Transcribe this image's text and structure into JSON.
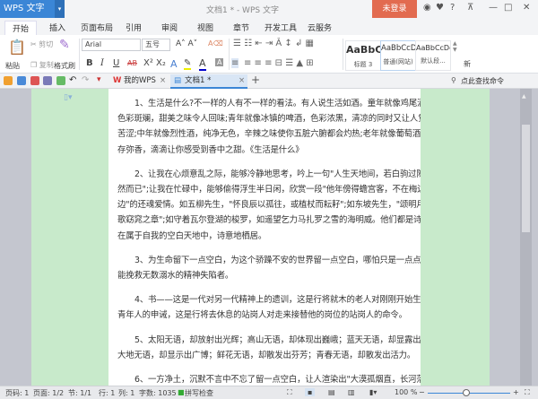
{
  "window": {
    "app_name": "WPS 文字",
    "title": "文档1 * - WPS 文字",
    "login": "未登录",
    "help": "?"
  },
  "tabs": [
    "开始",
    "插入",
    "页面布局",
    "引用",
    "审阅",
    "视图",
    "章节",
    "开发工具",
    "云服务"
  ],
  "ribbon": {
    "paste": "粘贴",
    "cut": "剪切",
    "copy": "复制",
    "format_painter": "格式刷",
    "font": "Arial",
    "size": "五号",
    "bold": "B",
    "italic": "I",
    "underline": "U",
    "strike": "AB",
    "styles": [
      {
        "preview": "AaBbC",
        "name": "标题 3"
      },
      {
        "preview": "AaBbCcD",
        "name": "普通(网站)"
      },
      {
        "preview": "AaBbCcDc",
        "name": "默认段..."
      }
    ],
    "new_style": "新"
  },
  "doc_tabs": [
    {
      "label": "我的WPS"
    },
    {
      "label": "文档1 *"
    }
  ],
  "search": "点此查找命令",
  "document": {
    "paragraphs": [
      [
        "1、生活是什么?不一样的人有不一样的看法。有人说生活如酒。童年就像鸡尾酒，",
        "色彩斑斓，甜美之味令人回味;青年就像冰镇的啤酒，色彩浓黑，清凉的同时又让人觉得",
        "苦涩;中年就像烈性酒，纯净无色，辛辣之味使你五脏六腑都会灼热;老年就像葡萄酒，久",
        "存弥香，滴滴让你感受到香中之甜。《生活是什么》"
      ],
      [
        "2、让我在心烦意乱之际，能够冷静地思考，吟上一句\"人生天地间，若白驹过隙，忽",
        "然而已\";让我在忙碌中，能够偷得浮生半日闲，欣赏一段\"他年傍得蟾宫客，不在梅边在柳",
        "边\"的还魂爱情。如五柳先生，\"怀良辰以孤往，或植杖而耘耔\";如东坡先生，\"颂明月之诗，",
        "歌窈窕之章\";如守着瓦尔登湖的梭罗，如遥望乞力马扎罗之雪的海明威。他们都是诗人，",
        "在属于自我的空白天地中，诗意地栖居。"
      ],
      [
        "3、为生命留下一点空白，为这个骄躁不安的世界留一点空白，哪怕只是一点点，却",
        "能挽救无数溺水的精神失陷者。"
      ],
      [
        "4、书——这是一代对另一代精神上的遗训，这是行将就木的老人对刚刚开始生活的",
        "青年人的申诫，这是行将去休息的站岗人对走来接替他的岗位的站岗人的命令。"
      ],
      [
        "5、太阳无语，却放射出光辉；高山无语，却体现出巍峨；蓝天无语，却显露出高远；",
        "大地无语，却显示出广博；鲜花无语，却散发出芬芳；青春无语，却散发出活力。"
      ],
      [
        "6、一方净土，沉默不言中不忘了留一点空白，让人渲染出\"大漠孤烟直，长河落日圆\"",
        "的奇观。"
      ]
    ]
  },
  "status": {
    "page_num": "页码: 1",
    "pages": "页面: 1/2",
    "section": "节: 1/1",
    "row": "行: 1",
    "col": "列: 1",
    "words": "字数: 1035",
    "spell": "拼写检查",
    "zoom": "100 %",
    "zoom_level": 100
  },
  "colors": {
    "accent": "#3b86d6",
    "login": "#e26b50",
    "doc_bg": "#c8eacb"
  }
}
